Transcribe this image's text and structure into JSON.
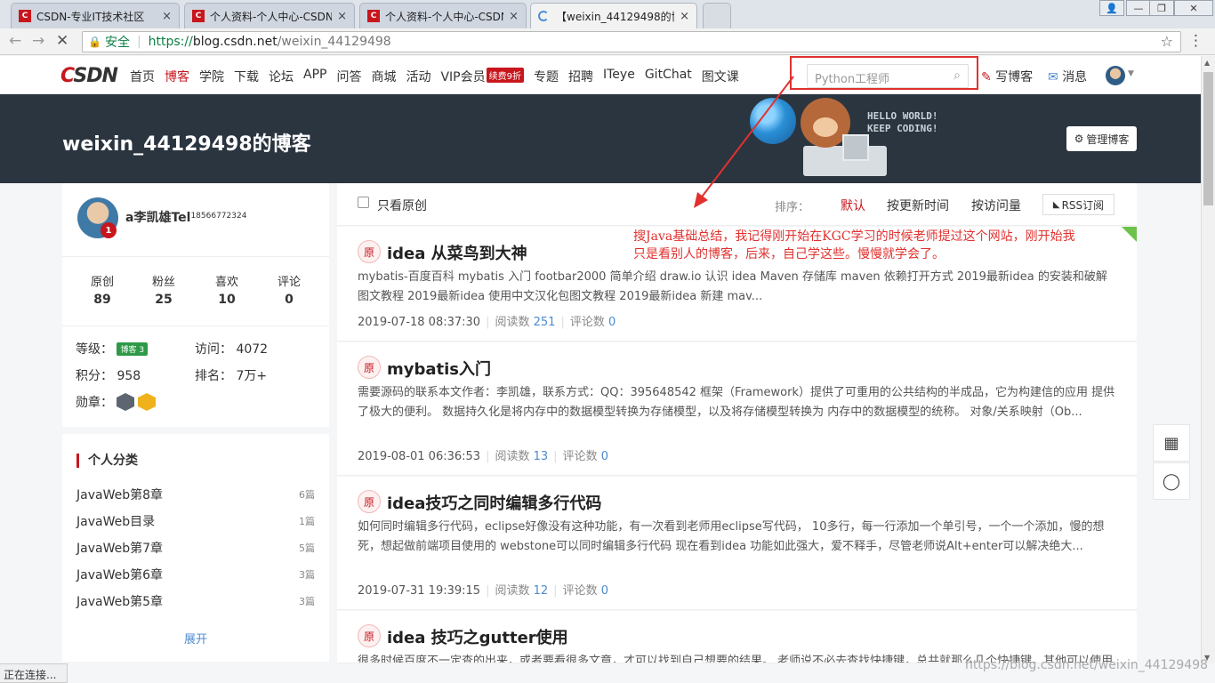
{
  "browser": {
    "tabs": [
      {
        "title": "CSDN-专业IT技术社区",
        "favicon": "C"
      },
      {
        "title": "个人资料-个人中心-CSDN",
        "favicon": "C"
      },
      {
        "title": "个人资料-个人中心-CSDN",
        "favicon": "C"
      },
      {
        "title": "【weixin_44129498的博",
        "favicon": ""
      }
    ],
    "window_controls": [
      "👤",
      "—",
      "❐",
      "✕"
    ],
    "back": "←",
    "forward": "→",
    "reload": "✕",
    "url": {
      "secure_label": "安全",
      "protocol": "https://",
      "host": "blog.csdn.net",
      "path": "/weixin_44129498"
    }
  },
  "site": {
    "logo_c": "C",
    "logo_rest": "SDN",
    "nav": [
      "首页",
      "博客",
      "学院",
      "下载",
      "论坛",
      "APP",
      "问答",
      "商城",
      "活动",
      "VIP会员",
      "专题",
      "招聘",
      "ITeye",
      "GitChat",
      "图文课"
    ],
    "vip_badge": "续费9折",
    "search_placeholder": "Python工程师",
    "write_blog": "写博客",
    "messages": "消息"
  },
  "banner": {
    "title": "weixin_44129498的博客",
    "hello_line1": "HELLO WORLD!",
    "hello_line2": "KEEP CODING!",
    "manage": "管理博客"
  },
  "profile": {
    "name": "a李凯雄Tel",
    "phone": "18566772324",
    "level_num": "1",
    "stats": [
      {
        "label": "原创",
        "value": "89"
      },
      {
        "label": "粉丝",
        "value": "25"
      },
      {
        "label": "喜欢",
        "value": "10"
      },
      {
        "label": "评论",
        "value": "0"
      }
    ],
    "level_label": "等级：",
    "level_badge": "博客 3",
    "visits_label": "访问：",
    "visits": "4072",
    "points_label": "积分：",
    "points": "958",
    "rank_label": "排名：",
    "rank": "7万+",
    "medals_label": "勋章："
  },
  "categories": {
    "title": "个人分类",
    "items": [
      {
        "name": "JavaWeb第8章",
        "count": "6篇"
      },
      {
        "name": "JavaWeb目录",
        "count": "1篇"
      },
      {
        "name": "JavaWeb第7章",
        "count": "5篇"
      },
      {
        "name": "JavaWeb第6章",
        "count": "3篇"
      },
      {
        "name": "JavaWeb第5章",
        "count": "3篇"
      }
    ],
    "expand": "展开"
  },
  "filter": {
    "only_original": "只看原创",
    "sort_label": "排序：",
    "sort_default": "默认",
    "sort_updated": "按更新时间",
    "sort_visits": "按访问量",
    "rss": "RSS订阅"
  },
  "annotation": "搜Java基础总结，我记得刚开始在KGC学习的时候老师提过这个网站，刚开始我只是看别人的博客，后来，自己学这些。慢慢就学会了。",
  "articles": [
    {
      "tag": "原",
      "title": "idea 从菜鸟到大神",
      "desc": "mybatis-百度百科 mybatis 入门 footbar2000 简单介绍 draw.io 认识 idea Maven 存储库 maven 依赖打开方式 2019最新idea 的安装和破解图文教程 2019最新idea 使用中文汉化包图文教程 2019最新idea 新建 mav...",
      "date": "2019-07-18 08:37:30",
      "reads_label": "阅读数",
      "reads": "251",
      "comments_label": "评论数",
      "comments": "0",
      "pinned": "置顶"
    },
    {
      "tag": "原",
      "title": "mybatis入门",
      "desc": "需要源码的联系本文作者：李凯雄，联系方式：QQ：395648542 框架（Framework）提供了可重用的公共结构的半成品，它为构建信的应用 提供了极大的便利。 数据持久化是将内存中的数据模型转换为存储模型，以及将存储模型转换为 内存中的数据模型的统称。 对象/关系映射（Ob...",
      "date": "2019-08-01 06:36:53",
      "reads_label": "阅读数",
      "reads": "13",
      "comments_label": "评论数",
      "comments": "0"
    },
    {
      "tag": "原",
      "title": "idea技巧之同时编辑多行代码",
      "desc": "如何同时编辑多行代码，eclipse好像没有这种功能，有一次看到老师用eclipse写代码， 10多行，每一行添加一个单引号，一个一个添加，慢的想死，想起做前端项目使用的 webstone可以同时编辑多行代码 现在看到idea 功能如此强大，爱不释手，尽管老师说Alt+enter可以解决绝大...",
      "date": "2019-07-31 19:39:15",
      "reads_label": "阅读数",
      "reads": "12",
      "comments_label": "评论数",
      "comments": "0"
    },
    {
      "tag": "原",
      "title": "idea 技巧之gutter使用",
      "desc": "很多时候百度不一定查的出来，或者要看很多文章，才可以找到自己想要的结果。 老师说不必去查找快捷键，总共就那么几个快捷键，其他可以使用鼠标实现。问题是我 现在连鼠标怎么实现都不知道，全部是英文的图标，好多单词都不知道是什么意思，没有办法我先汉"
    }
  ],
  "float_tools": [
    "▦",
    "◯"
  ],
  "status_text": "正在连接...",
  "watermark": "https://blog.csdn.net/weixin_44129498",
  "colors": {
    "brand_red": "#c8161d",
    "banner_bg": "#2b3540",
    "link_blue": "#4d8ad0",
    "annotation_red": "#e0312f"
  }
}
